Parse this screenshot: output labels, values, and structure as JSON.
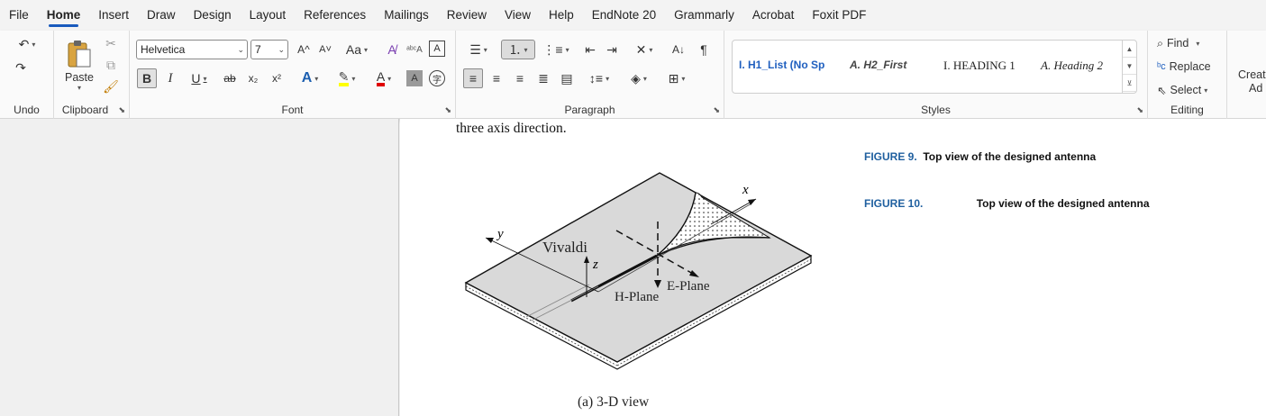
{
  "menu": {
    "tabs": [
      "File",
      "Home",
      "Insert",
      "Draw",
      "Design",
      "Layout",
      "References",
      "Mailings",
      "Review",
      "View",
      "Help",
      "EndNote 20",
      "Grammarly",
      "Acrobat",
      "Foxit PDF"
    ],
    "active": "Home"
  },
  "ribbon": {
    "groups": {
      "undo": "Undo",
      "clipboard": "Clipboard",
      "font": "Font",
      "paragraph": "Paragraph",
      "styles": "Styles",
      "editing": "Editing"
    },
    "clipboard": {
      "paste_label": "Paste"
    },
    "font": {
      "family": "Helvetica",
      "size": "7",
      "grow": "A^",
      "shrink": "A˅",
      "change_case": "Aa",
      "bold": "B",
      "italic": "I",
      "underline": "U",
      "strikethrough": "ab",
      "subscript": "x₂",
      "superscript": "x²"
    },
    "styles": {
      "items": [
        "I. H1_List (No Sp",
        "A. H2_First",
        "I. HEADING 1",
        "A. Heading 2"
      ]
    },
    "editing": {
      "find": "Find",
      "replace": "Replace",
      "select": "Select"
    },
    "create": {
      "line1": "Create",
      "line2": "Ad"
    },
    "colors": {
      "accent": "#185abd",
      "highlight": "#ffff00",
      "font_color": "#e00000"
    }
  },
  "document": {
    "body_line": "three axis direction.",
    "captions": [
      {
        "fig": "FIGURE 9.",
        "text": "Top view of the designed antenna"
      },
      {
        "fig": "FIGURE 10.",
        "text": "Top view of the designed antenna"
      }
    ],
    "figure": {
      "vivaldi": "Vivaldi",
      "h_plane": "H-Plane",
      "e_plane": "E-Plane",
      "axis_x": "x",
      "axis_y": "y",
      "axis_z": "z",
      "subcaption": "(a) 3-D view"
    }
  }
}
